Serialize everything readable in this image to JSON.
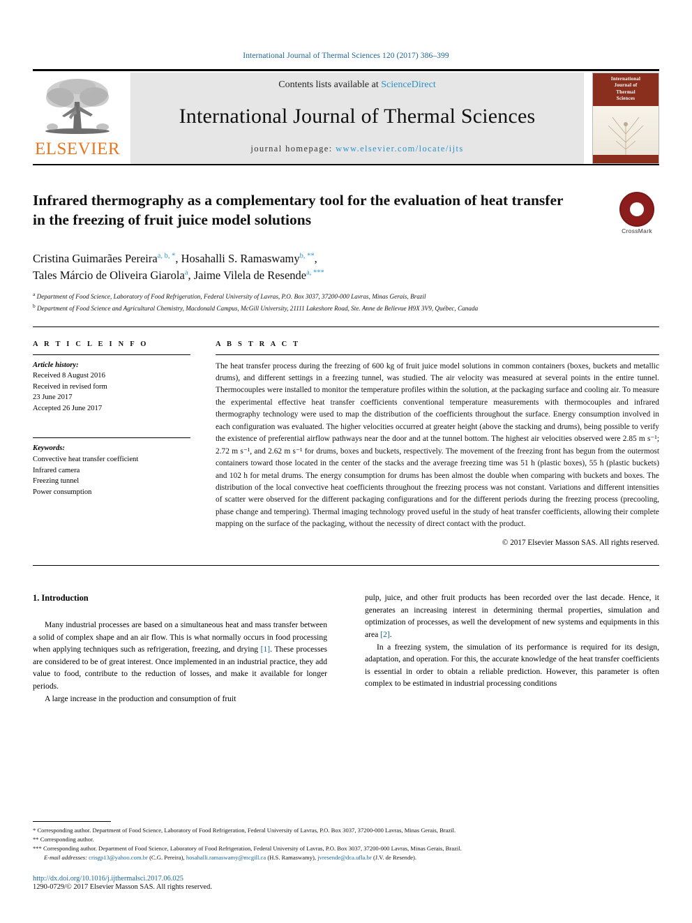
{
  "running_head": "International Journal of Thermal Sciences 120 (2017) 386–399",
  "masthead": {
    "publisher_logo_text": "ELSEVIER",
    "contents_prefix": "Contents lists available at ",
    "contents_link": "ScienceDirect",
    "journal_title": "International Journal of Thermal Sciences",
    "homepage_label": "journal homepage:",
    "homepage_url": "www.elsevier.com/locate/ijts",
    "cover": {
      "line1": "International",
      "line2": "Journal of",
      "line3": "Thermal",
      "line4": "Sciences"
    }
  },
  "article": {
    "title": "Infrared thermography as a complementary tool for the evaluation of heat transfer in the freezing of fruit juice model solutions",
    "crossmark_label": "CrossMark",
    "authors_line1_name1": "Cristina Guimarães Pereira",
    "authors_line1_sup1": "a, b, *",
    "authors_line1_name2": ", Hosahalli S. Ramaswamy",
    "authors_line1_sup2": "b, **",
    "authors_line1_tail": ",",
    "authors_line2_name1": "Tales Márcio de Oliveira Giarola",
    "authors_line2_sup1": "a",
    "authors_line2_name2": ", Jaime Vilela de Resende",
    "authors_line2_sup2": "a, ***",
    "affiliation_a_mark": "a",
    "affiliation_a": "Department of Food Science, Laboratory of Food Refrigeration, Federal University of Lavras, P.O. Box 3037, 37200-000 Lavras, Minas Gerais, Brazil",
    "affiliation_b_mark": "b",
    "affiliation_b": "Department of Food Science and Agricultural Chemistry, Macdonald Campus, McGill University, 21111 Lakeshore Road, Ste. Anne de Bellevue H9X 3V9, Québec, Canada"
  },
  "article_info": {
    "heading": "A R T I C L E   I N F O",
    "history_label": "Article history:",
    "history_lines": [
      "Received 8 August 2016",
      "Received in revised form",
      "23 June 2017",
      "Accepted 26 June 2017"
    ],
    "keywords_label": "Keywords:",
    "keywords": [
      "Convective heat transfer coefficient",
      "Infrared camera",
      "Freezing tunnel",
      "Power consumption"
    ]
  },
  "abstract": {
    "heading": "A B S T R A C T",
    "text": "The heat transfer process during the freezing of 600 kg of fruit juice model solutions in common containers (boxes, buckets and metallic drums), and different settings in a freezing tunnel, was studied. The air velocity was measured at several points in the entire tunnel. Thermocouples were installed to monitor the temperature profiles within the solution, at the packaging surface and cooling air. To measure the experimental effective heat transfer coefficients conventional temperature measurements with thermocouples and infrared thermography technology were used to map the distribution of the coefficients throughout the surface. Energy consumption involved in each configuration was evaluated. The higher velocities occurred at greater height (above the stacking and drums), being possible to verify the existence of preferential airflow pathways near the door and at the tunnel bottom. The highest air velocities observed were 2.85 m s⁻¹; 2.72 m s⁻¹, and 2.62 m s⁻¹ for drums, boxes and buckets, respectively. The movement of the freezing front has begun from the outermost containers toward those located in the center of the stacks and the average freezing time was 51 h (plastic boxes), 55 h (plastic buckets) and 102 h for metal drums. The energy consumption for drums has been almost the double when comparing with buckets and boxes. The distribution of the local convective heat coefficients throughout the freezing process was not constant. Variations and different intensities of scatter were observed for the different packaging configurations and for the different periods during the freezing process (precooling, phase change and tempering). Thermal imaging technology proved useful in the study of heat transfer coefficients, allowing their complete mapping on the surface of the packaging, without the necessity of direct contact with the product.",
    "copyright": "© 2017 Elsevier Masson SAS. All rights reserved."
  },
  "introduction": {
    "section_number": "1.",
    "section_title": "Introduction",
    "left_para_1_a": "Many industrial processes are based on a simultaneous heat and mass transfer between a solid of complex shape and an air flow. This is what normally occurs in food processing when applying techniques such as refrigeration, freezing, and drying ",
    "left_para_1_ref": "[1]",
    "left_para_1_b": ". These processes are considered to be of great interest. Once implemented in an industrial practice, they add value to food, contribute to the reduction of losses, and make it available for longer periods.",
    "left_para_2": "A large increase in the production and consumption of fruit",
    "right_para_1_a": "pulp, juice, and other fruit products has been recorded over the last decade. Hence, it generates an increasing interest in determining thermal properties, simulation and optimization of processes, as well the development of new systems and equipments in this area ",
    "right_para_1_ref": "[2]",
    "right_para_1_b": ".",
    "right_para_2": "In a freezing system, the simulation of its performance is required for its design, adaptation, and operation. For this, the accurate knowledge of the heat transfer coefficients is essential in order to obtain a reliable prediction. However, this parameter is often complex to be estimated in industrial processing conditions"
  },
  "footnotes": {
    "note1_mark": "*",
    "note1": "Corresponding author. Department of Food Science, Laboratory of Food Refrigeration, Federal University of Lavras, P.O. Box 3037, 37200-000 Lavras, Minas Gerais, Brazil.",
    "note2_mark": "**",
    "note2": "Corresponding author.",
    "note3_mark": "***",
    "note3": "Corresponding author. Department of Food Science, Laboratory of Food Refrigeration, Federal University of Lavras, P.O. Box 3037, 37200-000 Lavras, Minas Gerais, Brazil.",
    "email_label": "E-mail addresses:",
    "email1": "crisgp13@yahoo.com.br",
    "email1_owner": "(C.G. Pereira),",
    "email2": "hosahalli.ramaswamy@mcgill.ca",
    "email2_owner": "(H.S. Ramaswamy),",
    "email3": "jvresende@dca.ufla.br",
    "email3_owner": "(J.V. de Resende).",
    "doi": "http://dx.doi.org/10.1016/j.ijthermalsci.2017.06.025",
    "issn": "1290-0729/© 2017 Elsevier Masson SAS. All rights reserved."
  },
  "colors": {
    "link_blue": "#1a6496",
    "science_direct_blue": "#2a93c9",
    "elsevier_orange": "#E87722",
    "crossmark_red": "#8c1d1d"
  }
}
